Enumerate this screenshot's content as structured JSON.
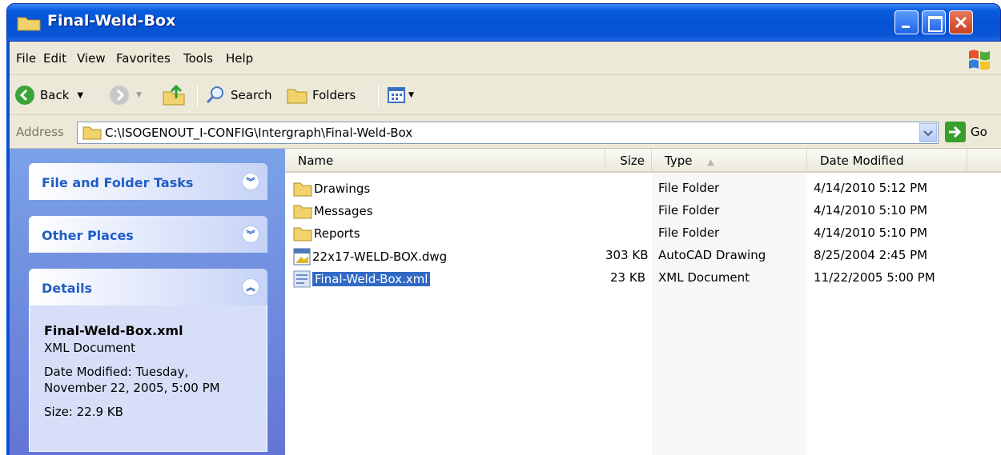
{
  "window": {
    "title": "Final-Weld-Box"
  },
  "menu": [
    "File",
    "Edit",
    "View",
    "Favorites",
    "Tools",
    "Help"
  ],
  "toolbar": {
    "back": "Back",
    "search": "Search",
    "folders": "Folders"
  },
  "address": {
    "label": "Address",
    "path": "C:\\ISOGENOUT_I-CONFIG\\Intergraph\\Final-Weld-Box",
    "go": "Go"
  },
  "taskpane": {
    "file_tasks": "File and Folder Tasks",
    "other_places": "Other Places",
    "details": {
      "title": "Details",
      "name": "Final-Weld-Box.xml",
      "type": "XML Document",
      "modified_1": "Date Modified: Tuesday,",
      "modified_2": "November 22, 2005, 5:00 PM",
      "size": "Size: 22.9 KB"
    }
  },
  "columns": {
    "name": "Name",
    "size": "Size",
    "type": "Type",
    "date": "Date Modified"
  },
  "files": [
    {
      "name": "Drawings",
      "size": "",
      "type": "File Folder",
      "date": "4/14/2010 5:12 PM",
      "icon": "folder-icon"
    },
    {
      "name": "Messages",
      "size": "",
      "type": "File Folder",
      "date": "4/14/2010 5:10 PM",
      "icon": "folder-icon"
    },
    {
      "name": "Reports",
      "size": "",
      "type": "File Folder",
      "date": "4/14/2010 5:10 PM",
      "icon": "folder-icon"
    },
    {
      "name": "22x17-WELD-BOX.dwg",
      "size": "303 KB",
      "type": "AutoCAD Drawing",
      "date": "8/25/2004 2:45 PM",
      "icon": "dwg-file-icon"
    },
    {
      "name": "Final-Weld-Box.xml",
      "size": "23 KB",
      "type": "XML Document",
      "date": "11/22/2005 5:00 PM",
      "icon": "xml-file-icon"
    }
  ],
  "selected_index": 4
}
